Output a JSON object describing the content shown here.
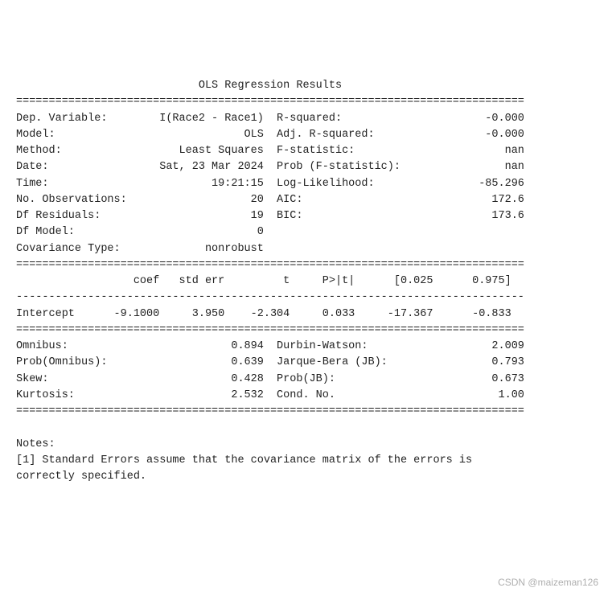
{
  "title": "OLS Regression Results",
  "rule": "==============================================================================",
  "rule_dash": "------------------------------------------------------------------------------",
  "header_left": [
    {
      "label": "Dep. Variable:",
      "value": "I(Race2 - Race1)"
    },
    {
      "label": "Model:",
      "value": "OLS"
    },
    {
      "label": "Method:",
      "value": "Least Squares"
    },
    {
      "label": "Date:",
      "value": "Sat, 23 Mar 2024"
    },
    {
      "label": "Time:",
      "value": "19:21:15"
    },
    {
      "label": "No. Observations:",
      "value": "20"
    },
    {
      "label": "Df Residuals:",
      "value": "19"
    },
    {
      "label": "Df Model:",
      "value": "0"
    },
    {
      "label": "Covariance Type:",
      "value": "nonrobust"
    }
  ],
  "header_right": [
    {
      "label": "R-squared:",
      "value": "-0.000"
    },
    {
      "label": "Adj. R-squared:",
      "value": "-0.000"
    },
    {
      "label": "F-statistic:",
      "value": "nan"
    },
    {
      "label": "Prob (F-statistic):",
      "value": "nan"
    },
    {
      "label": "Log-Likelihood:",
      "value": "-85.296"
    },
    {
      "label": "AIC:",
      "value": "172.6"
    },
    {
      "label": "BIC:",
      "value": "173.6"
    }
  ],
  "coef_header": [
    "",
    "coef",
    "std err",
    "t",
    "P>|t|",
    "[0.025",
    "0.975]"
  ],
  "coef_rows": [
    {
      "name": "Intercept",
      "coef": "-9.1000",
      "stderr": "3.950",
      "t": "-2.304",
      "p": "0.033",
      "lo": "-17.367",
      "hi": "-0.833"
    }
  ],
  "diag_left": [
    {
      "label": "Omnibus:",
      "value": "0.894"
    },
    {
      "label": "Prob(Omnibus):",
      "value": "0.639"
    },
    {
      "label": "Skew:",
      "value": "0.428"
    },
    {
      "label": "Kurtosis:",
      "value": "2.532"
    }
  ],
  "diag_right": [
    {
      "label": "Durbin-Watson:",
      "value": "2.009"
    },
    {
      "label": "Jarque-Bera (JB):",
      "value": "0.793"
    },
    {
      "label": "Prob(JB):",
      "value": "0.673"
    },
    {
      "label": "Cond. No.",
      "value": "1.00"
    }
  ],
  "notes_heading": "Notes:",
  "notes": [
    "[1] Standard Errors assume that the covariance matrix of the errors is correctly specified."
  ],
  "watermark": "CSDN @maizeman126"
}
